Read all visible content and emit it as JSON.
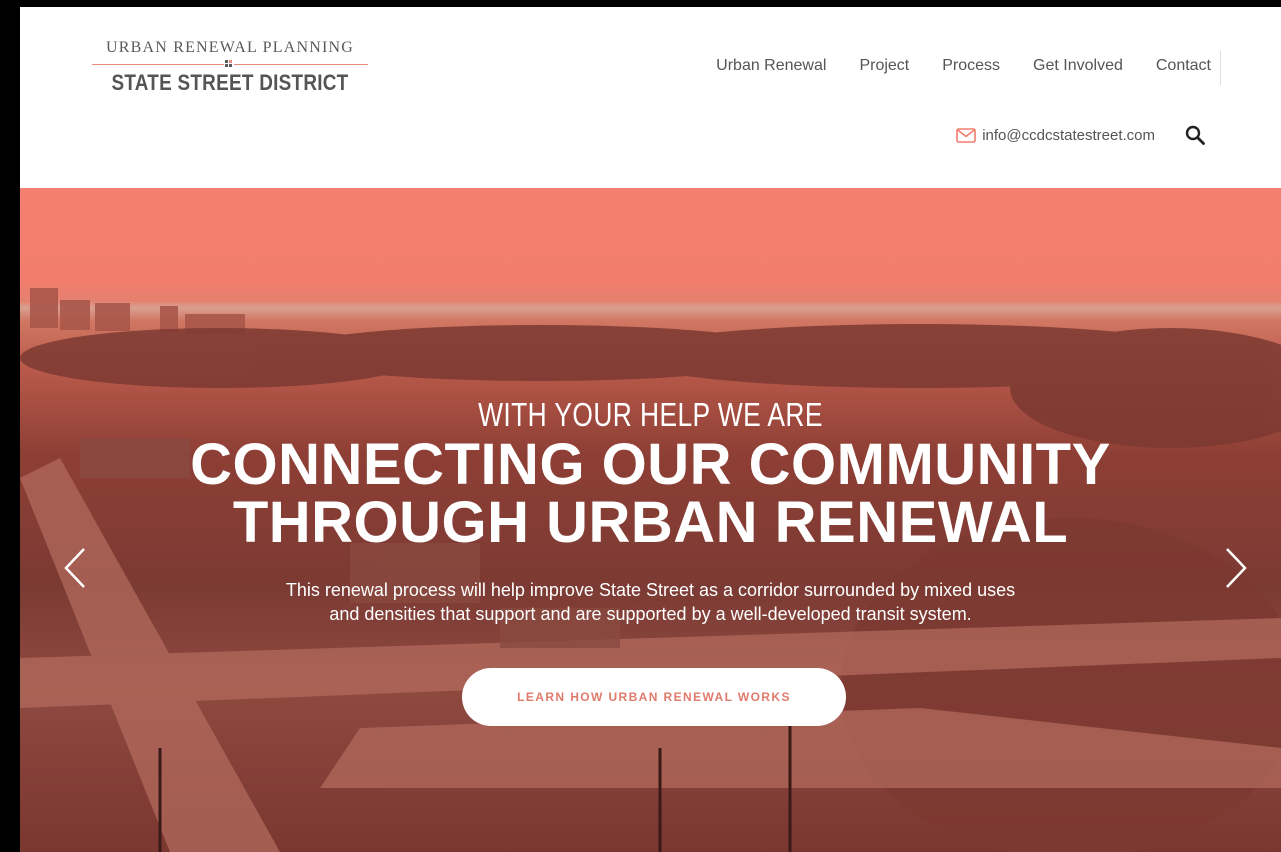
{
  "header": {
    "logo": {
      "top_line": "URBAN RENEWAL PLANNING",
      "bottom_line": "STATE STREET DISTRICT"
    },
    "nav": [
      {
        "label": "Urban Renewal"
      },
      {
        "label": "Project"
      },
      {
        "label": "Process"
      },
      {
        "label": "Get Involved"
      },
      {
        "label": "Contact"
      }
    ],
    "email": "info@ccdcstatestreet.com",
    "icons": {
      "mail": "mail-icon",
      "search": "search-icon"
    }
  },
  "hero": {
    "kicker": "WITH YOUR HELP WE ARE",
    "title_line1": "CONNECTING OUR COMMUNITY",
    "title_line2": "THROUGH URBAN RENEWAL",
    "body_line1": "This renewal process will help improve State Street as a corridor surrounded by mixed uses",
    "body_line2": "and densities that support and are supported by a well-developed transit system.",
    "cta_label": "LEARN HOW URBAN RENEWAL WORKS",
    "icons": {
      "prev": "chevron-left-icon",
      "next": "chevron-right-icon"
    }
  },
  "colors": {
    "accent": "#f47f70",
    "text_gray": "#555555",
    "cta_text": "#e07b6b"
  }
}
